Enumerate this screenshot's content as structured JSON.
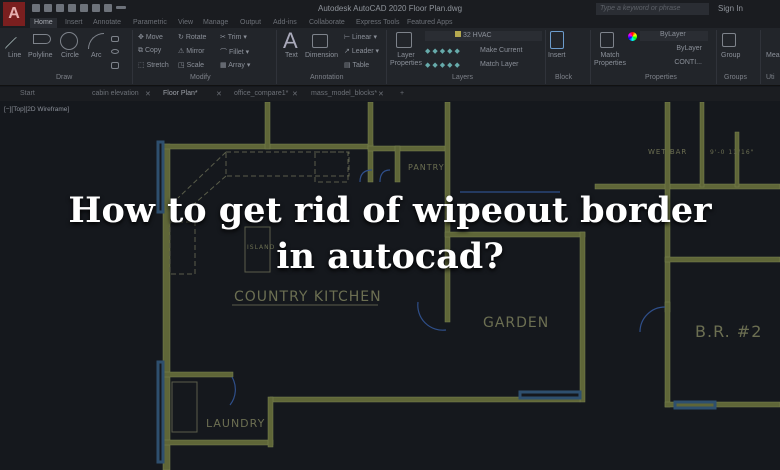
{
  "app": {
    "title": "Autodesk AutoCAD 2020   Floor Plan.dwg",
    "logo": "A",
    "search_placeholder": "Type a keyword or phrase",
    "sign_in": "Sign In"
  },
  "ribbon_tabs": [
    "Home",
    "Insert",
    "Annotate",
    "Parametric",
    "View",
    "Manage",
    "Output",
    "Add-ins",
    "Collaborate",
    "Express Tools",
    "Featured Apps"
  ],
  "draw": {
    "tools": [
      "Line",
      "Polyline",
      "Circle",
      "Arc"
    ],
    "panel": "Draw"
  },
  "modify": {
    "tools": [
      "Move",
      "Rotate",
      "Trim",
      "Copy",
      "Mirror",
      "Fillet",
      "Stretch",
      "Scale",
      "Array"
    ],
    "panel": "Modify"
  },
  "annotation": {
    "tools": [
      "Text",
      "Dimension",
      "Linear",
      "Leader",
      "Table"
    ],
    "panel": "Annotation"
  },
  "layers": {
    "current": "32 HVAC",
    "layer_properties": "Layer Properties",
    "make_current": "Make Current",
    "match_layer": "Match Layer",
    "panel": "Layers"
  },
  "block": {
    "insert": "Insert",
    "panel": "Block"
  },
  "properties": {
    "match": "Match Properties",
    "color": "ByLayer",
    "lineweight": "ByLayer",
    "linetype": "CONTI...",
    "panel": "Properties"
  },
  "groups": {
    "group": "Group",
    "panel": "Groups"
  },
  "utilities": {
    "measure": "Mea",
    "panel": "Uti"
  },
  "doc_tabs": [
    "Start",
    "cabin elevation",
    "Floor Plan*",
    "office_compare1*",
    "mass_model_blocks*"
  ],
  "active_doc_tab": "Floor Plan*",
  "view_label": "[−][Top][2D Wireframe]",
  "rooms": {
    "pantry": "PANTRY",
    "wet_bar": "WET BAR",
    "dimension": "9'-0 11/16\"",
    "island": "ISLAND",
    "kitchen": "COUNTRY KITCHEN",
    "garden": "GARDEN",
    "br2": "B.R. #2",
    "laundry": "LAUNDRY"
  },
  "headline": {
    "line1": "How to get rid of wipeout border",
    "line2": "in autocad?"
  },
  "colors": {
    "wall": "#6b7240",
    "door": "#2f4f8a",
    "hatch": "#2e4f6e",
    "background": "#15181d"
  }
}
